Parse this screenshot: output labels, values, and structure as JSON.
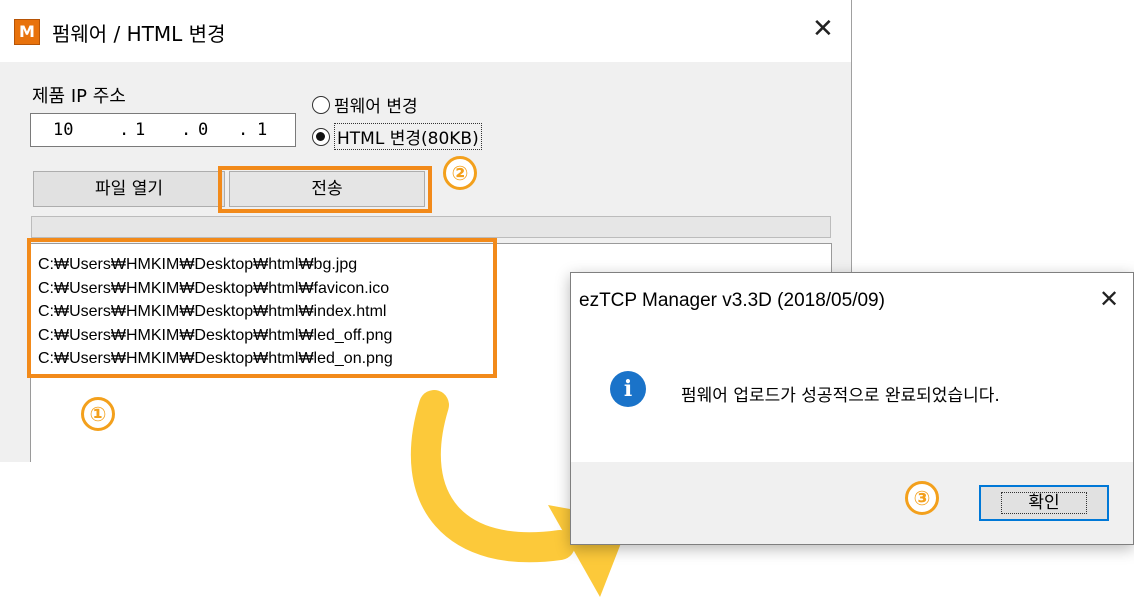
{
  "firmware_window": {
    "title": "펌웨어 / HTML 변경",
    "icon_letter": "M",
    "close_label": "✕",
    "ip_label": "제품 IP 주소",
    "ip_octets": [
      "10",
      "1",
      "0",
      "1"
    ],
    "ip_dot": ".",
    "radio_firmware_label": "펌웨어 변경",
    "radio_html_label": "HTML 변경(80KB)",
    "selected_mode": "HTML 변경(80KB)",
    "open_file_label": "파일 열기",
    "send_label": "전송",
    "files": [
      "C:₩Users₩HMKIM₩Desktop₩html₩bg.jpg",
      "C:₩Users₩HMKIM₩Desktop₩html₩favicon.ico",
      "C:₩Users₩HMKIM₩Desktop₩html₩index.html",
      "C:₩Users₩HMKIM₩Desktop₩html₩led_off.png",
      "C:₩Users₩HMKIM₩Desktop₩html₩led_on.png"
    ]
  },
  "dialog": {
    "title": "ezTCP Manager v3.3D (2018/05/09)",
    "close_label": "✕",
    "icon": "info-icon",
    "icon_glyph": "i",
    "message": "펌웨어 업로드가 성공적으로 완료되었습니다.",
    "ok_label": "확인"
  },
  "annotations": {
    "step1": "①",
    "step2": "②",
    "step3": "③",
    "highlight_color": "#f28a1a",
    "arrow_color": "#fcc93a"
  }
}
